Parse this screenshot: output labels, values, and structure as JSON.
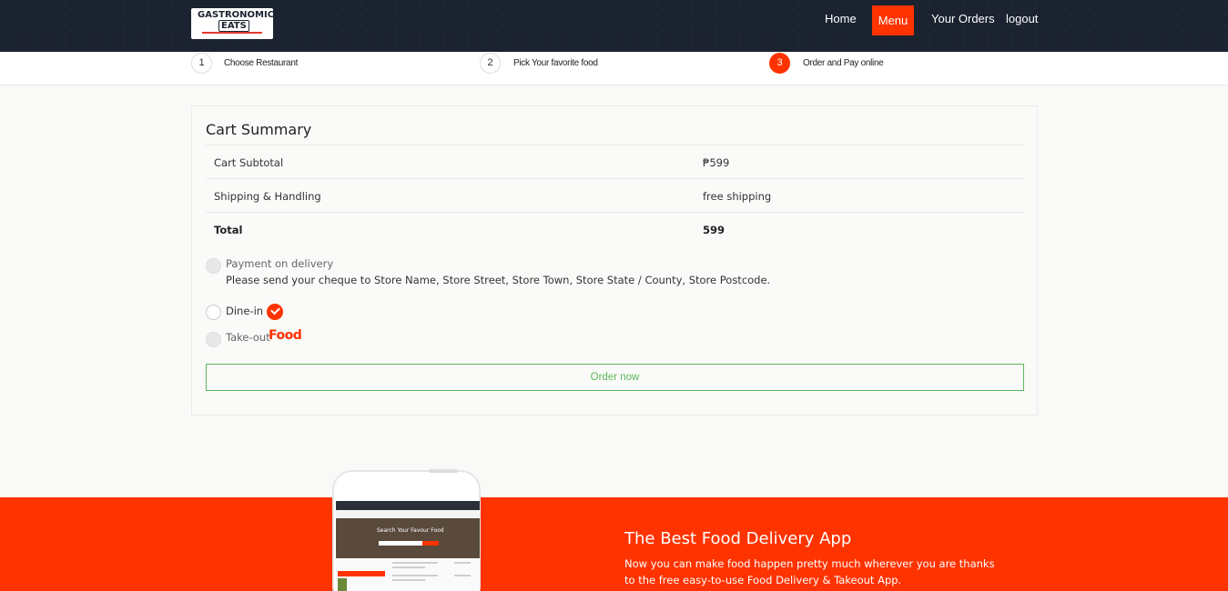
{
  "header": {
    "logo_text_top": "GASTRONOMIC",
    "logo_text_bottom": "EATS",
    "nav": {
      "home": "Home",
      "menu": "Menu",
      "orders": "Your Orders",
      "logout": "logout"
    },
    "accent_color": "#ff3300",
    "bg_color": "#1b2230"
  },
  "steps": [
    {
      "num": "1",
      "label": "Choose Restaurant",
      "active": false
    },
    {
      "num": "2",
      "label": "Pick Your favorite food",
      "active": false
    },
    {
      "num": "3",
      "label": "Order and Pay online",
      "active": true
    }
  ],
  "cart": {
    "title": "Cart Summary",
    "rows": [
      {
        "label": "Cart Subtotal",
        "value": "₱599"
      },
      {
        "label": "Shipping & Handling",
        "value": "free shipping"
      },
      {
        "label": "Total",
        "value": "599"
      }
    ],
    "payment_label": "Payment on delivery",
    "payment_note": "Please send your cheque to Store Name, Store Street, Store Town, Store State / County, Store Postcode.",
    "dine_in_label": "Dine-in",
    "take_out_label": "Take-out",
    "food_icon_text": "Food",
    "order_button": "Order now"
  },
  "promo": {
    "title": "The Best Food Delivery App",
    "text": "Now you can make food happen pretty much wherever you are thanks to the free easy-to-use Food Delivery & Takeout App.",
    "phone_hero_title": "Search Your Favour Food"
  }
}
